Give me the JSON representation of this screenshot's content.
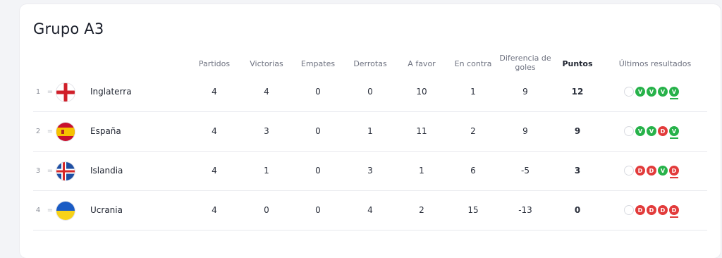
{
  "group": {
    "title": "Grupo A3"
  },
  "columns": {
    "partidos": "Partidos",
    "victorias": "Victorias",
    "empates": "Empates",
    "derrotas": "Derrotas",
    "a_favor": "A favor",
    "en_contra": "En contra",
    "diferencia_line1": "Diferencia de",
    "diferencia_line2": "goles",
    "puntos": "Puntos",
    "ultimos": "Últimos resultados"
  },
  "rows": [
    {
      "pos": "1",
      "trend": "=",
      "flag": "england-flag",
      "team": "Inglaterra",
      "pj": "4",
      "v": "4",
      "e": "0",
      "d": "0",
      "gf": "10",
      "gc": "1",
      "dif": "9",
      "pts": "12",
      "results": [
        "V",
        "V",
        "V",
        "V"
      ]
    },
    {
      "pos": "2",
      "trend": "=",
      "flag": "spain-flag",
      "team": "España",
      "pj": "4",
      "v": "3",
      "e": "0",
      "d": "1",
      "gf": "11",
      "gc": "2",
      "dif": "9",
      "pts": "9",
      "results": [
        "V",
        "V",
        "D",
        "V"
      ]
    },
    {
      "pos": "3",
      "trend": "=",
      "flag": "iceland-flag",
      "team": "Islandia",
      "pj": "4",
      "v": "1",
      "e": "0",
      "d": "3",
      "gf": "1",
      "gc": "6",
      "dif": "-5",
      "pts": "3",
      "results": [
        "D",
        "D",
        "V",
        "D"
      ]
    },
    {
      "pos": "4",
      "trend": "=",
      "flag": "ukraine-flag",
      "team": "Ucrania",
      "pj": "4",
      "v": "0",
      "e": "0",
      "d": "4",
      "gf": "2",
      "gc": "15",
      "dif": "-13",
      "pts": "0",
      "results": [
        "D",
        "D",
        "D",
        "D"
      ]
    }
  ],
  "colors": {
    "win": "#27b24a",
    "loss": "#e23b3b"
  }
}
